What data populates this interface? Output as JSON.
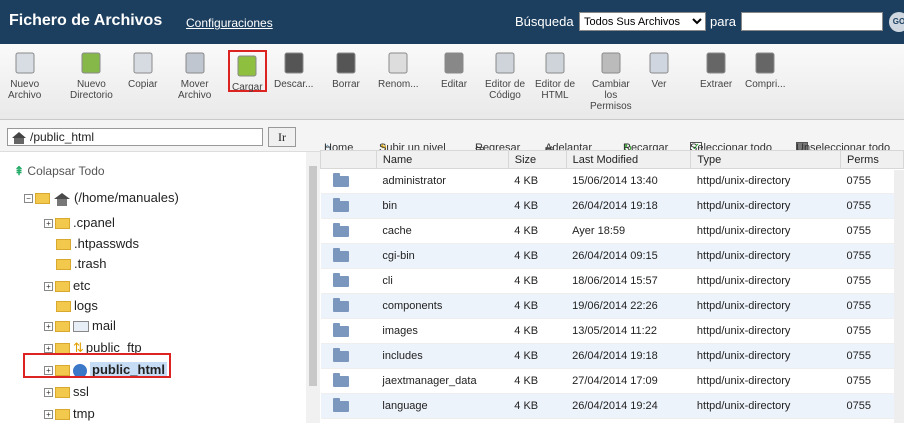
{
  "header": {
    "title": "Fichero de Archivos",
    "config_link": "Configuraciones",
    "search_label": "Búsqueda",
    "search_scope": "Todos Sus Archivos",
    "para_label": "para",
    "go_label": "GO"
  },
  "toolbar": {
    "items": [
      {
        "label": "Nuevo\nArchivo",
        "icon": "new-file-icon"
      },
      {
        "label": "Nuevo\nDirectorio",
        "icon": "new-folder-icon"
      },
      {
        "label": "Copiar",
        "icon": "copy-icon"
      },
      {
        "label": "Mover\nArchivo",
        "icon": "move-icon"
      },
      {
        "label": "Cargar",
        "icon": "upload-icon"
      },
      {
        "label": "Descar...",
        "icon": "download-icon"
      },
      {
        "label": "Borrar",
        "icon": "delete-icon"
      },
      {
        "label": "Renom...",
        "icon": "rename-icon"
      },
      {
        "label": "Editar",
        "icon": "edit-icon"
      },
      {
        "label": "Editor de\nCódigo",
        "icon": "code-editor-icon"
      },
      {
        "label": "Editor de\nHTML",
        "icon": "html-editor-icon"
      },
      {
        "label": "Cambiar\nlos\nPermisos",
        "icon": "permissions-icon"
      },
      {
        "label": "Ver",
        "icon": "view-icon"
      },
      {
        "label": "Extraer",
        "icon": "extract-icon"
      },
      {
        "label": "Compri...",
        "icon": "compress-icon"
      }
    ]
  },
  "left": {
    "path": "/public_html",
    "go_button": "Ir",
    "collapse_all": "Colapsar Todo",
    "root": "(/home/manuales)",
    "tree": [
      ".cpanel",
      ".htpasswds",
      ".trash",
      "etc",
      "logs",
      "mail",
      "public_ftp",
      "public_html",
      "ssl",
      "tmp"
    ]
  },
  "navbar": {
    "home": "Home",
    "up": "Subir un nivel",
    "back": "Regresar",
    "forward": "Adelantar",
    "reload": "Recargar",
    "select_all": "Seleccionar todo",
    "unselect_all": "Unseleccionar todo"
  },
  "table": {
    "columns": [
      "Name",
      "Size",
      "Last Modified",
      "Type",
      "Perms"
    ],
    "rows": [
      {
        "name": "administrator",
        "size": "4 KB",
        "modified": "15/06/2014 13:40",
        "type": "httpd/unix-directory",
        "perms": "0755"
      },
      {
        "name": "bin",
        "size": "4 KB",
        "modified": "26/04/2014 19:18",
        "type": "httpd/unix-directory",
        "perms": "0755"
      },
      {
        "name": "cache",
        "size": "4 KB",
        "modified": "Ayer 18:59",
        "type": "httpd/unix-directory",
        "perms": "0755"
      },
      {
        "name": "cgi-bin",
        "size": "4 KB",
        "modified": "26/04/2014 09:15",
        "type": "httpd/unix-directory",
        "perms": "0755"
      },
      {
        "name": "cli",
        "size": "4 KB",
        "modified": "18/06/2014 15:57",
        "type": "httpd/unix-directory",
        "perms": "0755"
      },
      {
        "name": "components",
        "size": "4 KB",
        "modified": "19/06/2014 22:26",
        "type": "httpd/unix-directory",
        "perms": "0755"
      },
      {
        "name": "images",
        "size": "4 KB",
        "modified": "13/05/2014 11:22",
        "type": "httpd/unix-directory",
        "perms": "0755"
      },
      {
        "name": "includes",
        "size": "4 KB",
        "modified": "26/04/2014 19:18",
        "type": "httpd/unix-directory",
        "perms": "0755"
      },
      {
        "name": "jaextmanager_data",
        "size": "4 KB",
        "modified": "27/04/2014 17:09",
        "type": "httpd/unix-directory",
        "perms": "0755"
      },
      {
        "name": "language",
        "size": "4 KB",
        "modified": "26/04/2014 19:24",
        "type": "httpd/unix-directory",
        "perms": "0755"
      }
    ]
  }
}
